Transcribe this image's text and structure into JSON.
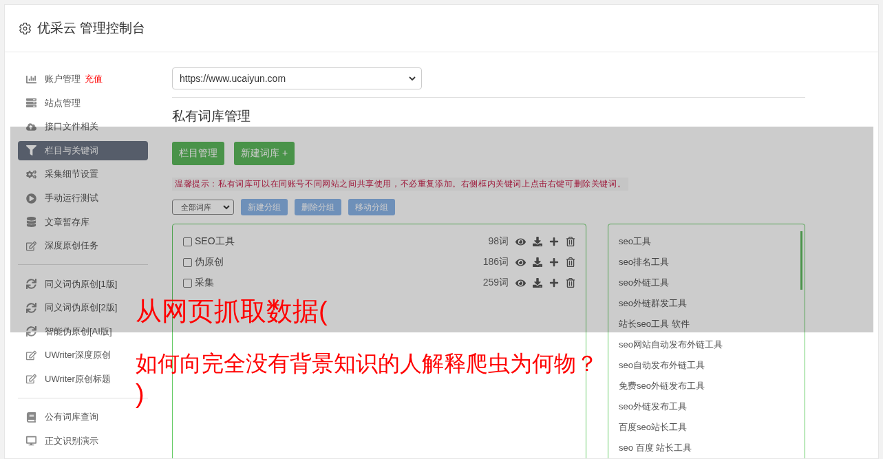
{
  "header": {
    "title": "优采云 管理控制台"
  },
  "sidebar": {
    "groups": [
      [
        {
          "label": "账户管理",
          "badge": "充值",
          "selected": false
        },
        {
          "label": "站点管理",
          "selected": false
        },
        {
          "label": "接口文件相关",
          "selected": false
        },
        {
          "label": "栏目与关键词",
          "selected": true
        },
        {
          "label": "采集细节设置",
          "selected": false
        },
        {
          "label": "手动运行测试",
          "selected": false
        },
        {
          "label": "文章暂存库",
          "selected": false
        },
        {
          "label": "深度原创任务",
          "selected": false
        }
      ],
      [
        {
          "label": "同义词伪原创[1版]",
          "selected": false
        },
        {
          "label": "同义词伪原创[2版]",
          "selected": false
        },
        {
          "label": "智能伪原创[AI版]",
          "selected": false
        },
        {
          "label": "UWriter深度原创",
          "selected": false
        },
        {
          "label": "UWriter原创标题",
          "selected": false
        }
      ],
      [
        {
          "label": "公有词库查询",
          "selected": false
        },
        {
          "label": "正文识别演示",
          "selected": false
        }
      ]
    ]
  },
  "site_select": {
    "value": "https://www.ucaiyun.com"
  },
  "section_title": "私有词库管理",
  "action_buttons": [
    "栏目管理",
    "新建词库 +"
  ],
  "tip": "温馨提示：私有词库可以在同账号不同网站之间共享使用，不必重复添加。右侧框内关键词上点击右键可删除关键词。",
  "group_select": {
    "value": "全部词库"
  },
  "group_buttons": [
    "新建分组",
    "删除分组",
    "移动分组"
  ],
  "libraries": [
    {
      "name": "SEO工具",
      "count": "98词",
      "checked": false
    },
    {
      "name": "伪原创",
      "count": "186词",
      "checked": false
    },
    {
      "name": "采集",
      "count": "259词",
      "checked": false
    }
  ],
  "keywords": [
    "seo工具",
    "seo排名工具",
    "seo外链工具",
    "seo外链群发工具",
    "站长seo工具 软件",
    "seo网站自动发布外链工具",
    "seo自动发布外链工具",
    "免费seo外链发布工具",
    "seo外链发布工具",
    "百度seo站长工具",
    "seo 百度 站长工具"
  ],
  "overlay_title": [
    "从网页抓取数据(",
    "如何向完全没有背景知识的人解释爬虫为何物？",
    ")"
  ]
}
